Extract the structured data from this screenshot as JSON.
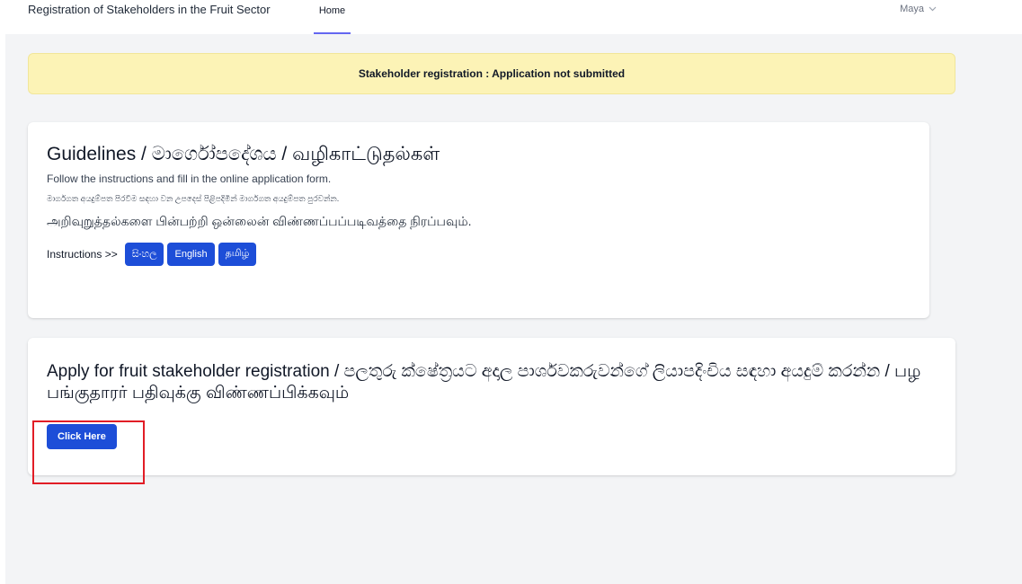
{
  "header": {
    "app_title": "Registration of Stakeholders in the Fruit Sector",
    "nav_home": "Home",
    "user_name": "Maya",
    "user_menu_icon": "chevron-down-icon"
  },
  "status_banner": {
    "text": "Stakeholder registration : Application not submitted",
    "background": "#fcf3b6"
  },
  "guidelines": {
    "title": "Guidelines / මාර්ගෝපදේශය / வழிகாட்டுதல்கள்",
    "line_en": "Follow the instructions and fill in the online application form.",
    "line_si": "මාර්ගගත අයදුම්පත පිරවීම සඳහා වන උපදෙස් පිළිපදිමින් මාර්ගගත අයදුම්පත පුරවන්න.",
    "line_ta": "அறிவுறுத்தல்களை பின்பற்றி ஒன்லைன் விண்ணப்பப்படிவத்தை நிரப்பவும்.",
    "instructions_label": "Instructions >>",
    "buttons": [
      "සිංහල",
      "English",
      "தமிழ்"
    ]
  },
  "apply": {
    "title": "Apply for fruit stakeholder registration / පලතුරු ක්ෂේත්‍රයට අදාල පාර්ශවකරුවන්ගේ ලියාපදිංචිය සඳහා අයදුම් කරන්න / பழ பங்குதாரர் பதிவுக்கு விண்ணப்பிக்கவும்",
    "button_label": "Click Here"
  },
  "colors": {
    "primary_button": "#1d4ed8",
    "highlight_border": "#e11d26",
    "nav_active_underline": "#6366f1"
  }
}
